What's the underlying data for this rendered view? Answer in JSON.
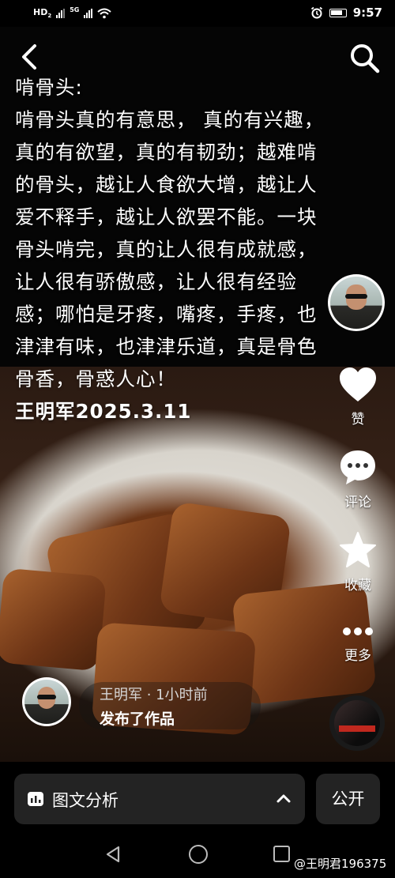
{
  "status_bar": {
    "hd_label": "HD",
    "sim2": "2",
    "network": "5G",
    "time": "9:57"
  },
  "post": {
    "title": "啃骨头:",
    "body": "啃骨头真的有意思， 真的有兴趣，真的有欲望，真的有韧劲；越难啃的骨头，越让人食欲大增，越让人爱不释手，越让人欲罢不能。一块骨头啃完，真的让人很有成就感，让人很有骄傲感，让人很有经验感；哪怕是牙疼，嘴疼，手疼，也津津有味，也津津乐道，真是骨色骨香，骨惑人心！",
    "signature": "王明军2025.3.11"
  },
  "actions": {
    "like": "赞",
    "comment": "评论",
    "favorite": "收藏",
    "more": "更多"
  },
  "notice": {
    "meta": "王明军 · 1小时前",
    "title": "发布了作品"
  },
  "bottom": {
    "analysis_label": "图文分析",
    "public_label": "公开"
  },
  "watermark": "@王明君196375",
  "colors": {
    "background": "#000000",
    "panel": "#232323",
    "text": "#ffffff"
  }
}
